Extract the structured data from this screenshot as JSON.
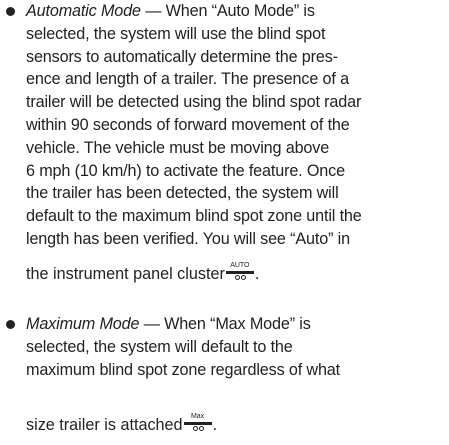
{
  "items": [
    {
      "lead": "Automatic Mode",
      "lines": [
        " — When “Auto Mode” is",
        "selected, the system will use the blind spot",
        "sensors to automatically determine the pres-",
        "ence and length of a trailer. The presence of a",
        "trailer will be detected using the blind spot radar",
        "within 90 seconds of forward movement of the",
        "vehicle. The vehicle must be moving above",
        "6 mph (10 km/h) to activate the feature. Once",
        "the trailer has been detected, the system will",
        "default to the maximum blind spot zone until the",
        "length has been verified. You will see “Auto” in"
      ],
      "last_line": "the instrument panel cluster",
      "icon_label": "AUTO",
      "icon_name": "trailer-auto-icon"
    },
    {
      "lead": "Maximum Mode",
      "lines": [
        " — When “Max Mode” is",
        "selected, the system will default to the",
        "maximum blind spot zone regardless of what"
      ],
      "last_line": "size trailer is attached",
      "icon_label": "Max",
      "icon_name": "trailer-max-icon"
    }
  ]
}
